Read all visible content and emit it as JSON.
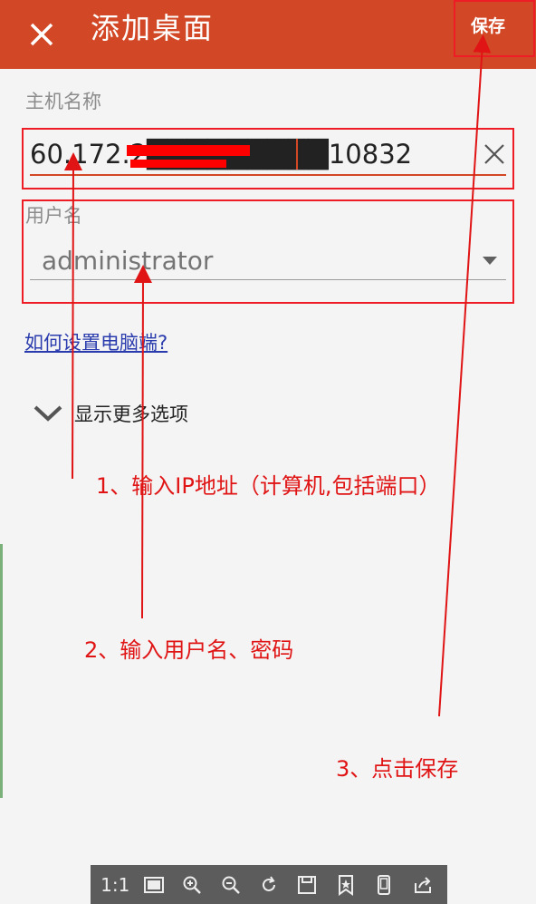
{
  "app_bar": {
    "title": "添加桌面",
    "save_label": "保存",
    "close_icon": "close-icon",
    "background_color": "#d24826"
  },
  "form": {
    "host_label": "主机名称",
    "host_value": "60.172.2█████████10832",
    "user_label": "用户名",
    "user_value": "administrator",
    "help_link": "如何设置电脑端?",
    "more_options": "显示更多选项"
  },
  "annotations": {
    "step1": "1、输入IP地址（计算机,包括端口）",
    "step2": "2、输入用户名、密码",
    "step3": "3、点击保存",
    "color": "#e01414"
  },
  "viewer_toolbar": {
    "ratio_label": "1:1",
    "icons": [
      "fit-screen-icon",
      "zoom-in-icon",
      "zoom-out-icon",
      "rotate-icon",
      "save-icon",
      "favorite-icon",
      "phone-icon",
      "share-icon"
    ]
  }
}
